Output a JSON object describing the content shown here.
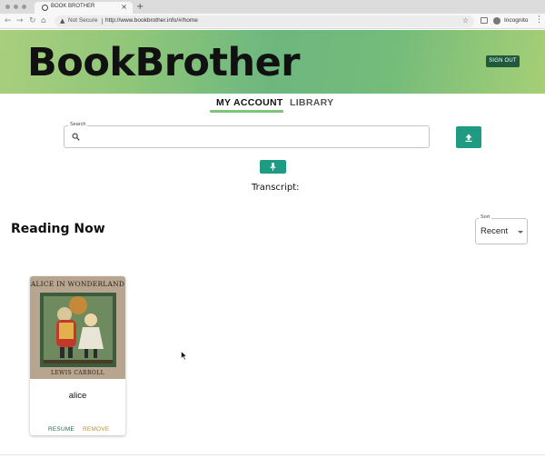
{
  "browser": {
    "tab_title": "BOOK BROTHER",
    "security_label": "Not Secure",
    "url": "http://www.bookbrother.info/#/home",
    "profile_label": "Incognito",
    "icons": [
      "back-icon",
      "forward-icon",
      "reload-icon",
      "home-icon",
      "warning-icon",
      "star-icon",
      "extension-icon",
      "incognito-icon",
      "menu-icon"
    ]
  },
  "header": {
    "logo": "BookBrother",
    "sign_out": "SIGN OUT",
    "colors": {
      "banner_left": "#a9cf7d",
      "banner_mid": "#6db77f",
      "sign_out_bg": "#1f5a3c"
    }
  },
  "tabs": {
    "my_account": "MY ACCOUNT",
    "library": "LIBRARY",
    "active": "MY ACCOUNT",
    "indicator_color": "#7cc47a"
  },
  "search": {
    "label": "Search",
    "value": "",
    "placeholder": ""
  },
  "actions": {
    "upload_icon": "upload-icon",
    "mic_icon": "microphone-icon",
    "button_color": "#1f9b84"
  },
  "transcript": {
    "label": "Transcript:"
  },
  "reading_now": {
    "title": "Reading Now",
    "sort_label": "Sort",
    "sort_value": "Recent",
    "books": [
      {
        "cover_title": "ALICE IN WONDERLAND",
        "cover_author": "LEWIS CARROLL",
        "title": "alice",
        "resume": "RESUME",
        "remove": "REMOVE"
      }
    ]
  }
}
